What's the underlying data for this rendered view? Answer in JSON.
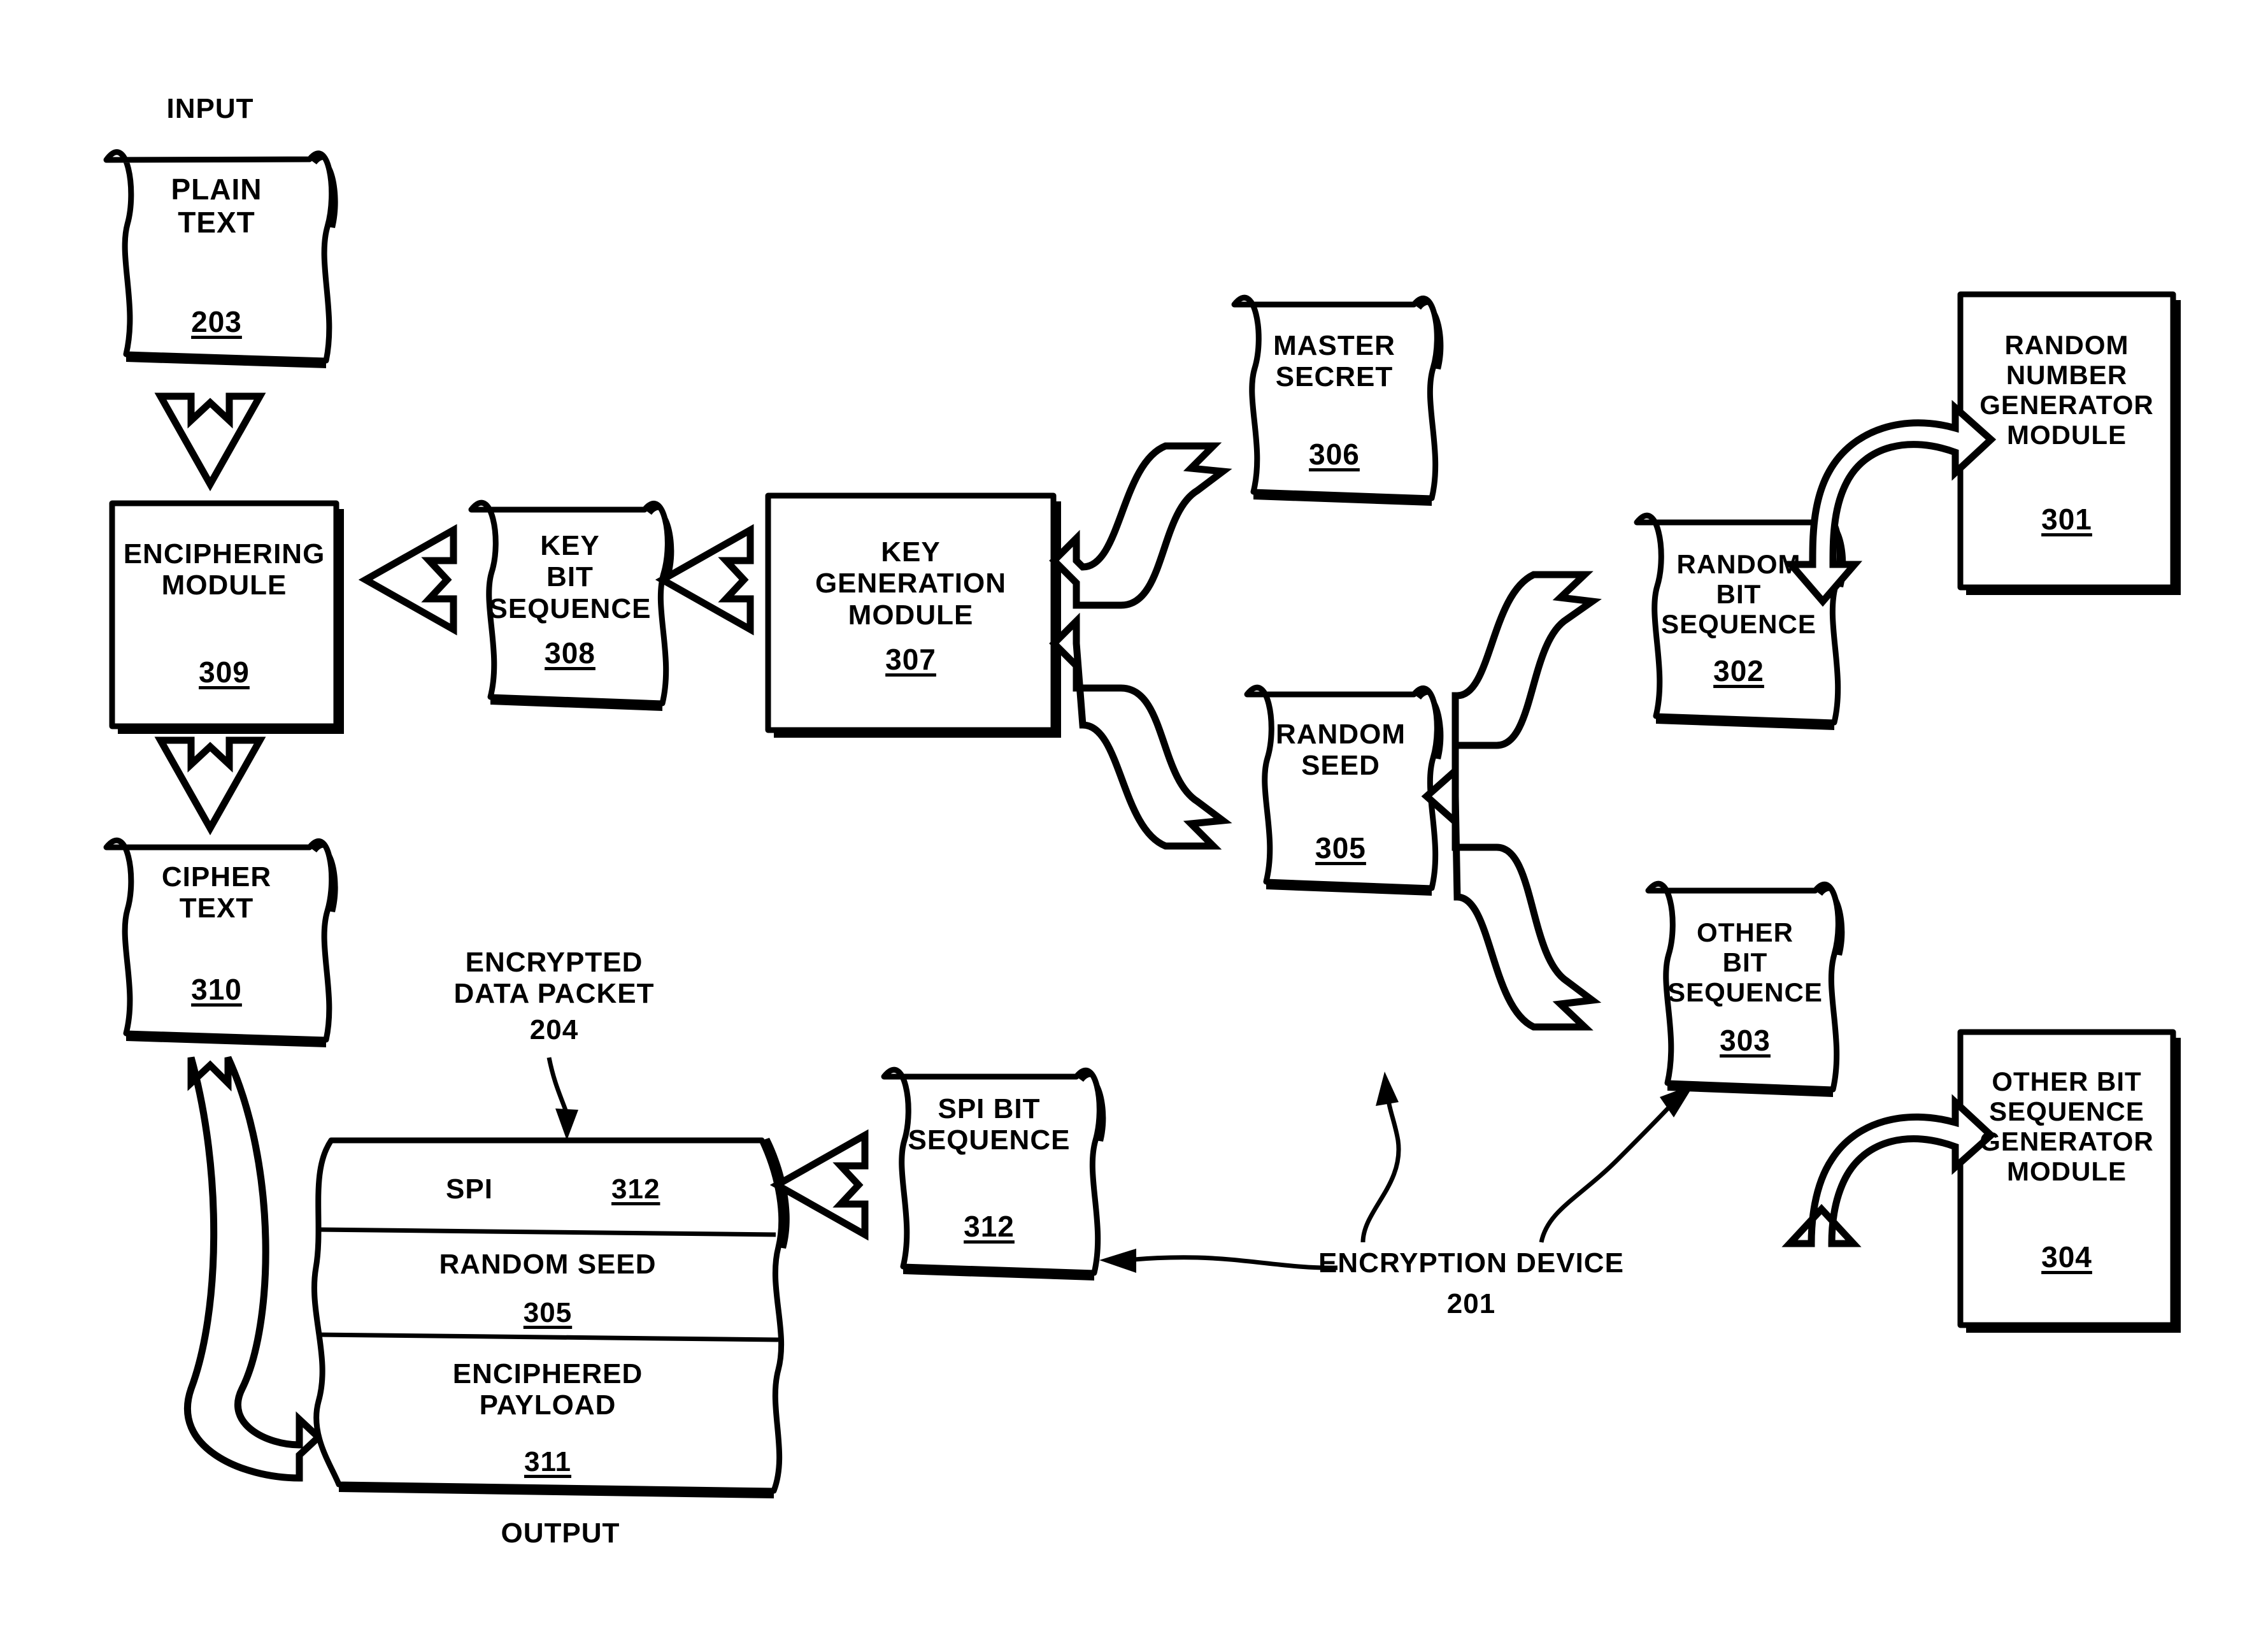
{
  "figure": {
    "title_labels": {
      "input": "INPUT",
      "output": "OUTPUT",
      "encrypted_data_packet": "ENCRYPTED\nDATA PACKET",
      "encrypted_data_packet_num": "204",
      "encryption_device": "ENCRYPTION DEVICE",
      "encryption_device_num": "201"
    },
    "nodes": [
      {
        "id": "plain_text",
        "shape": "document",
        "label": "PLAIN\nTEXT",
        "num": "203"
      },
      {
        "id": "enciphering",
        "shape": "box",
        "label": "ENCIPHERING\nMODULE",
        "num": "309"
      },
      {
        "id": "key_bit_seq",
        "shape": "document",
        "label": "KEY\nBIT\nSEQUENCE",
        "num": "308"
      },
      {
        "id": "key_gen",
        "shape": "box",
        "label": "KEY\nGENERATION\nMODULE",
        "num": "307"
      },
      {
        "id": "master_secret",
        "shape": "document",
        "label": "MASTER\nSECRET",
        "num": "306"
      },
      {
        "id": "random_seed",
        "shape": "document",
        "label": "RANDOM\nSEED",
        "num": "305"
      },
      {
        "id": "rng_module",
        "shape": "box",
        "label": "RANDOM\nNUMBER\nGENERATOR\nMODULE",
        "num": "301"
      },
      {
        "id": "random_bit_seq",
        "shape": "document",
        "label": "RANDOM\nBIT\nSEQUENCE",
        "num": "302"
      },
      {
        "id": "other_bit_seq",
        "shape": "document",
        "label": "OTHER\nBIT\nSEQUENCE",
        "num": "303"
      },
      {
        "id": "other_bit_gen",
        "shape": "box",
        "label": "OTHER BIT\nSEQUENCE\nGENERATOR\nMODULE",
        "num": "304"
      },
      {
        "id": "cipher_text",
        "shape": "document",
        "label": "CIPHER\nTEXT",
        "num": "310"
      },
      {
        "id": "spi_bit_seq",
        "shape": "document",
        "label": "SPI BIT\nSEQUENCE",
        "num": "312"
      }
    ],
    "packet": {
      "name": "encrypted-data-packet",
      "rows": [
        {
          "label": "SPI",
          "num": "312"
        },
        {
          "label": "RANDOM SEED",
          "num": "305"
        },
        {
          "label": "ENCIPHERED\nPAYLOAD",
          "num": "311"
        }
      ]
    },
    "colors": {
      "stroke": "#000000",
      "fill": "#ffffff",
      "background": "#ffffff"
    }
  }
}
